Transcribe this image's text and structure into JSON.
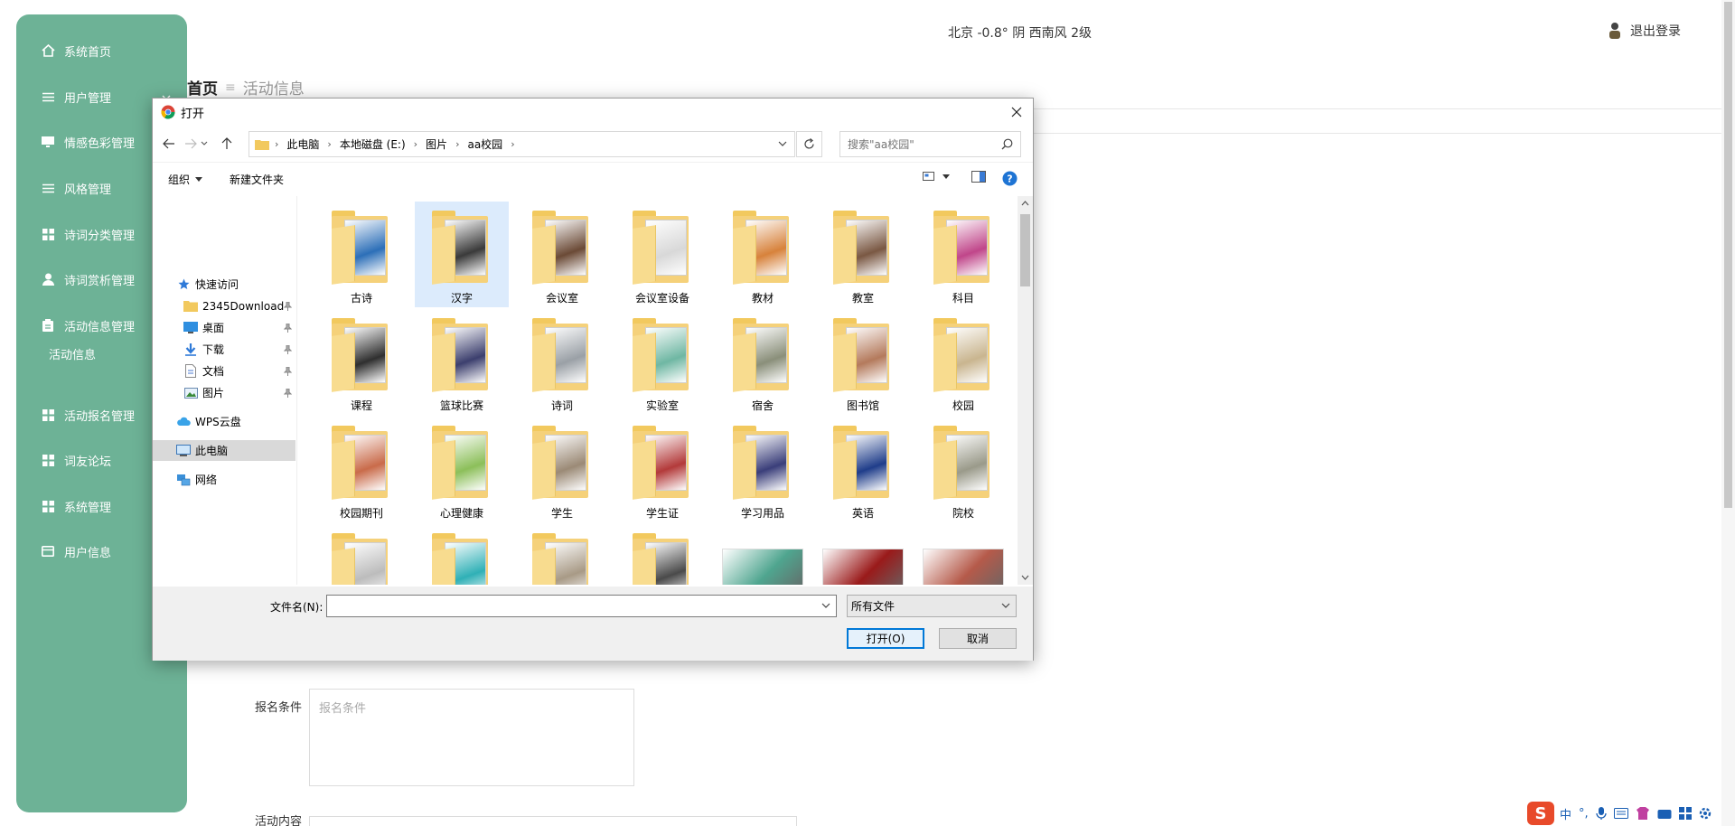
{
  "sidebar": {
    "items": [
      {
        "label": "系统首页",
        "icon": "home-icon"
      },
      {
        "label": "用户管理",
        "icon": "list-icon"
      },
      {
        "label": "情感色彩管理",
        "icon": "monitor-icon"
      },
      {
        "label": "风格管理",
        "icon": "list-icon"
      },
      {
        "label": "诗词分类管理",
        "icon": "grid-icon"
      },
      {
        "label": "诗词赏析管理",
        "icon": "user-icon"
      },
      {
        "label": "活动信息管理",
        "icon": "clipboard-icon"
      },
      {
        "label": "活动报名管理",
        "icon": "grid-icon"
      },
      {
        "label": "词友论坛",
        "icon": "grid-icon"
      },
      {
        "label": "系统管理",
        "icon": "grid-icon"
      },
      {
        "label": "用户信息",
        "icon": "card-icon"
      }
    ],
    "submenu": {
      "label": "活动信息"
    }
  },
  "header": {
    "weather": "北京  -0.8°  阴  西南风  2级",
    "logout": "退出登录"
  },
  "breadcrumb": {
    "home": "首页",
    "sep": "≡",
    "current": "活动信息"
  },
  "form": {
    "signup_label": "报名条件",
    "signup_placeholder": "报名条件",
    "content_label": "活动内容"
  },
  "dialog": {
    "title": "打开",
    "address": [
      "此电脑",
      "本地磁盘 (E:)",
      "图片",
      "aa校园"
    ],
    "search_placeholder": "搜索\"aa校园\"",
    "toolbar": {
      "organize": "组织",
      "new_folder": "新建文件夹"
    },
    "nav": [
      {
        "label": "快速访问",
        "icon": "star-icon"
      },
      {
        "label": "2345Download",
        "icon": "folder-icon"
      },
      {
        "label": "桌面",
        "icon": "desktop-icon"
      },
      {
        "label": "下载",
        "icon": "download-icon"
      },
      {
        "label": "文档",
        "icon": "document-icon"
      },
      {
        "label": "图片",
        "icon": "picture-icon"
      },
      {
        "label": "WPS云盘",
        "icon": "cloud-icon"
      },
      {
        "label": "此电脑",
        "icon": "computer-icon"
      },
      {
        "label": "网络",
        "icon": "network-icon"
      }
    ],
    "folders": [
      {
        "name": "古诗",
        "tint": "#2c6fb8"
      },
      {
        "name": "汉字",
        "tint": "#3a3a3a"
      },
      {
        "name": "会议室",
        "tint": "#6b4a36"
      },
      {
        "name": "会议室设备",
        "tint": "#d8d8d8"
      },
      {
        "name": "教材",
        "tint": "#d7823b"
      },
      {
        "name": "教室",
        "tint": "#7a5843"
      },
      {
        "name": "科目",
        "tint": "#c0468a"
      },
      {
        "name": "课程",
        "tint": "#2f2f2f"
      },
      {
        "name": "篮球比赛",
        "tint": "#3c3f6e"
      },
      {
        "name": "诗词",
        "tint": "#9aa0a6"
      },
      {
        "name": "实验室",
        "tint": "#6fb7a3"
      },
      {
        "name": "宿舍",
        "tint": "#8a8f7a"
      },
      {
        "name": "图书馆",
        "tint": "#b47a5c"
      },
      {
        "name": "校园",
        "tint": "#c9b58f"
      },
      {
        "name": "校园期刊",
        "tint": "#c96b4a"
      },
      {
        "name": "心理健康",
        "tint": "#8cbf5a"
      },
      {
        "name": "学生",
        "tint": "#9b8a76"
      },
      {
        "name": "学生证",
        "tint": "#b33a3a"
      },
      {
        "name": "学习用品",
        "tint": "#3a3e7a"
      },
      {
        "name": "英语",
        "tint": "#1f3d8a"
      },
      {
        "name": "院校",
        "tint": "#9a9a8a"
      },
      {
        "name": "",
        "tint": "#bcbcbc"
      },
      {
        "name": "",
        "tint": "#2fb0b6"
      },
      {
        "name": "",
        "tint": "#a89a86"
      },
      {
        "name": "",
        "tint": "#4a4a4a"
      }
    ],
    "photos": [
      {
        "tint": "#4fa58f"
      },
      {
        "tint": "#9a1a1a"
      },
      {
        "tint": "#b55a4a"
      }
    ],
    "filename_label": "文件名(N):",
    "filename_value": "",
    "filetype": "所有文件",
    "open_button": "打开(O)",
    "cancel_button": "取消"
  },
  "tray": {
    "ime": "中",
    "punct": "°,"
  }
}
